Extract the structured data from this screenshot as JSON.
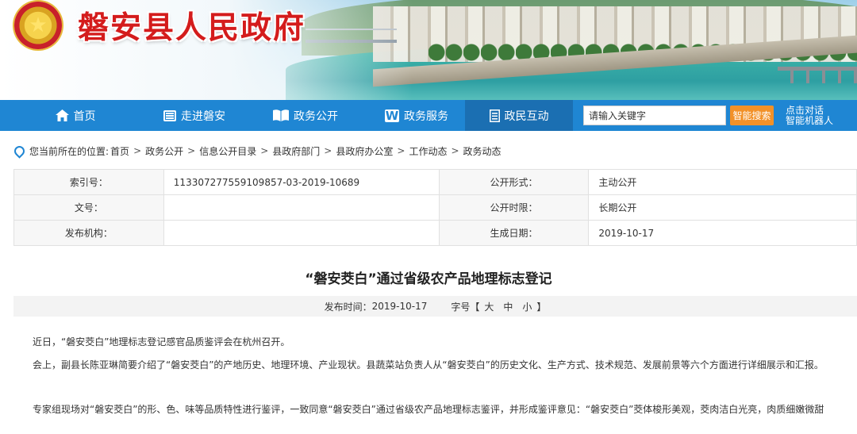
{
  "header": {
    "site_title": "磐安县人民政府",
    "emblem_icon": "national-emblem-icon",
    "brand_red": "#d41c1c"
  },
  "nav": {
    "bg_color": "#1f86d3",
    "active_color": "#1b6fb2",
    "items": [
      {
        "label": "首页",
        "icon": "home-icon"
      },
      {
        "label": "走进磐安",
        "icon": "list-icon"
      },
      {
        "label": "政务公开",
        "icon": "book-icon"
      },
      {
        "label": "政务服务",
        "icon": "w-icon"
      },
      {
        "label": "政民互动",
        "icon": "document-icon",
        "active": true
      }
    ],
    "search_placeholder": "请输入关键字",
    "search_button": "智能搜索",
    "search_button_color": "#f29128",
    "robot_line1": "点击对话",
    "robot_line2": "智能机器人"
  },
  "breadcrumb": {
    "prefix": "您当前所在的位置:",
    "items": [
      "首页",
      "政务公开",
      "信息公开目录",
      "县政府部门",
      "县政府办公室",
      "工作动态",
      "政务动态"
    ],
    "separator": ">"
  },
  "info": {
    "index_label": "索引号：",
    "index_value": "113307277559109857-03-2019-10689",
    "form_label": "公开形式：",
    "form_value": "主动公开",
    "docno_label": "文号：",
    "docno_value": "",
    "period_label": "公开时限：",
    "period_value": "长期公开",
    "org_label": "发布机构：",
    "org_value": "",
    "date_label": "生成日期：",
    "date_value": "2019-10-17"
  },
  "article": {
    "title": "“磐安茭白”通过省级农产品地理标志登记",
    "publish_label": "发布时间：",
    "publish_date": "2019-10-17",
    "fontsize_label": "字号【",
    "fontsize_large": "大",
    "fontsize_medium": "中",
    "fontsize_small": "小",
    "fontsize_end": "】",
    "paragraphs": [
      "近日，“磐安茭白”地理标志登记感官品质鉴评会在杭州召开。",
      "会上，副县长陈亚琳简要介绍了“磐安茭白”的产地历史、地理环境、产业现状。县蔬菜站负责人从“磐安茭白”的历史文化、生产方式、技术规范、发展前景等六个方面进行详细展示和汇报。",
      "专家组现场对“磐安茭白”的形、色、味等品质特性进行鉴评，一致同意“磐安茭白”通过省级农产品地理标志鉴评，并形成鉴评意见：“磐安茭白”茭体梭形美观，茭肉洁白光亮，肉质细嫩微甜"
    ]
  }
}
